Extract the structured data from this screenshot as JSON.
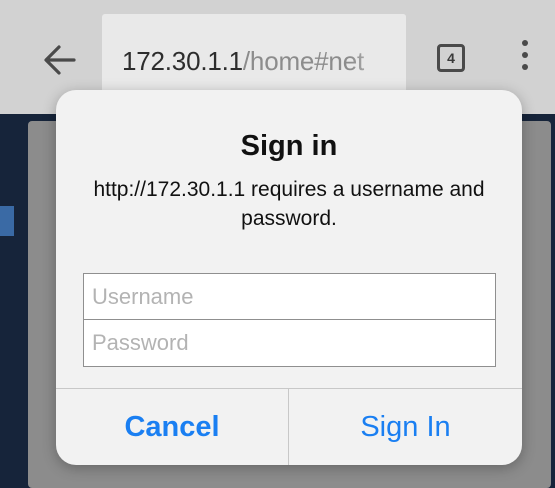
{
  "browser": {
    "url_host": "172.30.1.1",
    "url_path": "/home#net",
    "tab_count": "4",
    "icons": {
      "back": "arrow-left-icon",
      "tabs": "tab-switcher-icon",
      "menu": "vertical-dots-menu-icon"
    }
  },
  "dialog": {
    "title": "Sign in",
    "message": "http://172.30.1.1 requires a username and password.",
    "username_placeholder": "Username",
    "password_placeholder": "Password",
    "cancel_label": "Cancel",
    "signin_label": "Sign In"
  },
  "colors": {
    "toolbar": "#d2d2d2",
    "omnibox": "#e9e9e9",
    "dialog": "#f2f2f2",
    "button_text": "#1a7ff2",
    "page_backdrop": "#16243a"
  }
}
